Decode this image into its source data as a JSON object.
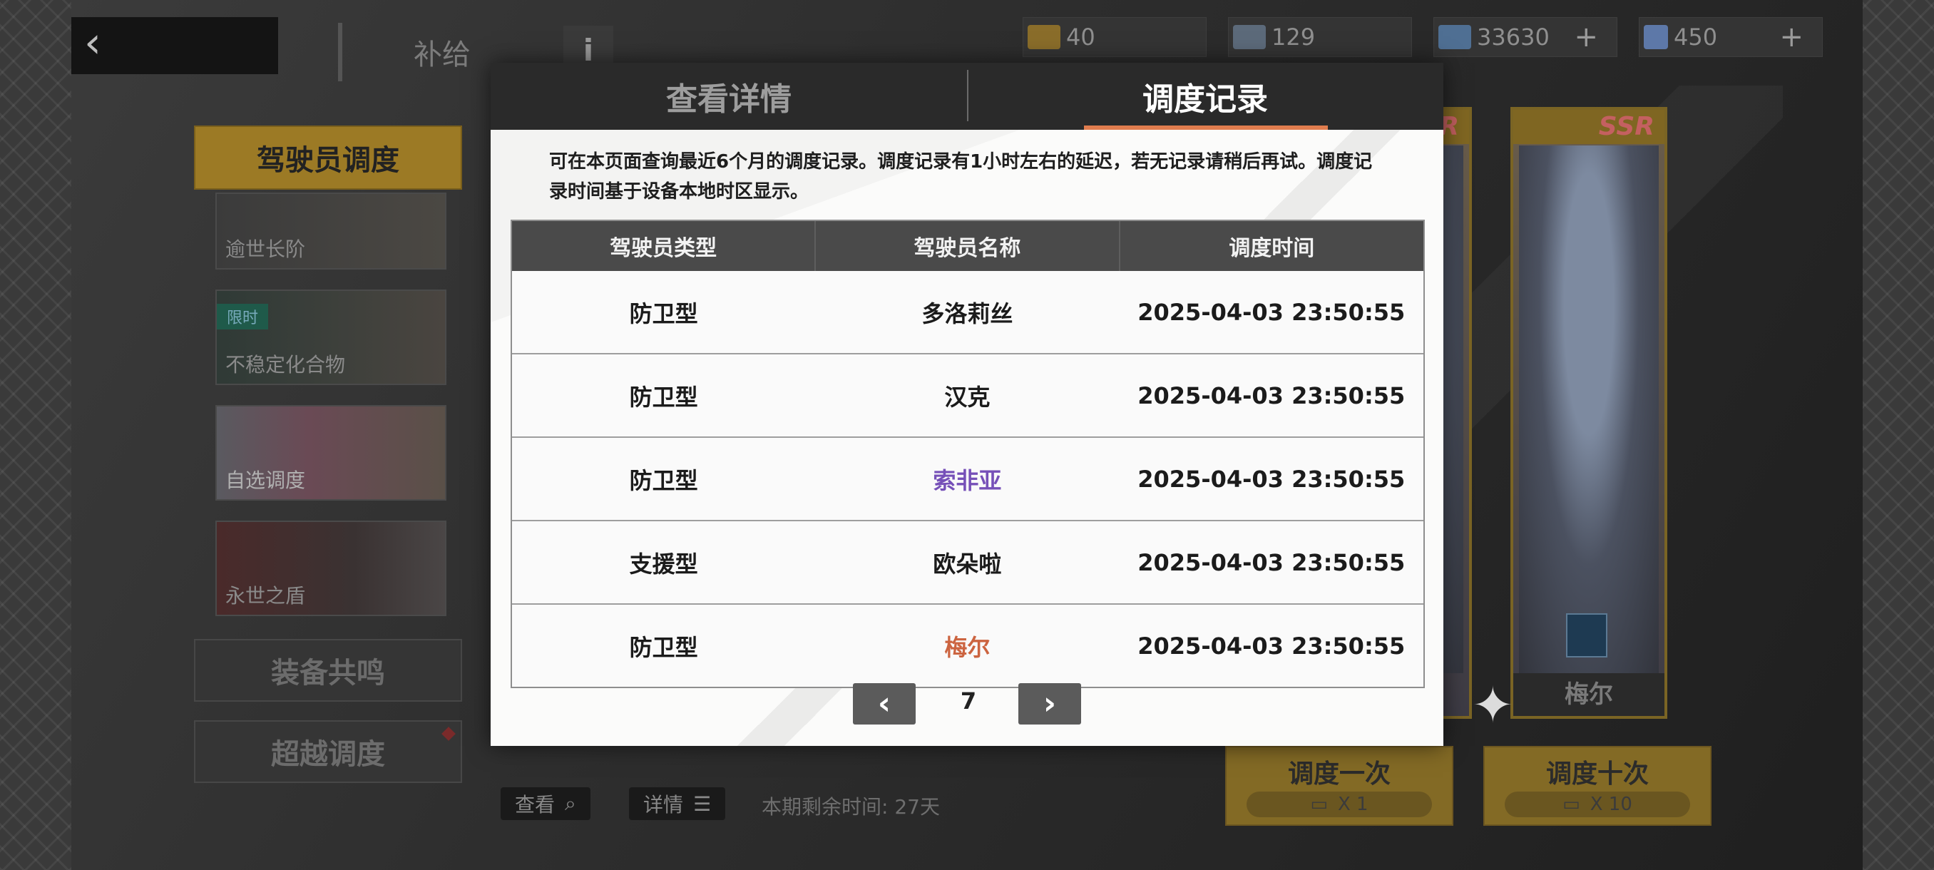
{
  "header": {
    "title": "补给",
    "info_label": "i",
    "currencies": [
      {
        "icon": "ticket-icon",
        "value": "40",
        "color": "#b08a3a"
      },
      {
        "icon": "blue-ticket-icon",
        "value": "129",
        "color": "#7a8ba0"
      },
      {
        "icon": "cube-icon",
        "value": "33630",
        "color": "#6f8fb3",
        "plus": "+"
      },
      {
        "icon": "crystal-icon",
        "value": "450",
        "color": "#8aa0c8",
        "plus": "+"
      }
    ]
  },
  "sidebar": {
    "active_label": "驾驶员调度",
    "banners": [
      {
        "label": "逾世长阶",
        "tag": ""
      },
      {
        "label": "不稳定化合物",
        "tag": "限时"
      },
      {
        "label": "自选调度",
        "tag": ""
      },
      {
        "label": "永世之盾",
        "tag": ""
      }
    ],
    "equip_label": "装备共鸣",
    "transcend_label": "超越调度"
  },
  "bottom": {
    "view_label": "查看",
    "detail_label": "详情",
    "remaining": "本期剩余时间: 27天"
  },
  "cards": {
    "rarity": "SSR",
    "featured_name": "梅尔"
  },
  "draw": {
    "once_label": "调度一次",
    "once_cost": "X 1",
    "ten_label": "调度十次",
    "ten_cost": "X 10"
  },
  "modal": {
    "tab_details": "查看详情",
    "tab_records": "调度记录",
    "notice": "可在本页面查询最近6个月的调度记录。调度记录有1小时左右的延迟，若无记录请稍后再试。调度记录时间基于设备本地时区显示。",
    "columns": [
      "驾驶员类型",
      "驾驶员名称",
      "调度时间"
    ],
    "rows": [
      {
        "type": "防卫型",
        "name": "多洛莉丝",
        "time": "2025-04-03 23:50:55",
        "rarity_color": ""
      },
      {
        "type": "防卫型",
        "name": "汉克",
        "time": "2025-04-03 23:50:55",
        "rarity_color": ""
      },
      {
        "type": "防卫型",
        "name": "索非亚",
        "time": "2025-04-03 23:50:55",
        "rarity_color": "#7650b8"
      },
      {
        "type": "支援型",
        "name": "欧朵啦",
        "time": "2025-04-03 23:50:55",
        "rarity_color": ""
      },
      {
        "type": "防卫型",
        "name": "梅尔",
        "time": "2025-04-03 23:50:55",
        "rarity_color": "#cc6440"
      }
    ],
    "page": "7",
    "prev_icon": "chevron-left-icon",
    "next_icon": "chevron-right-icon"
  }
}
